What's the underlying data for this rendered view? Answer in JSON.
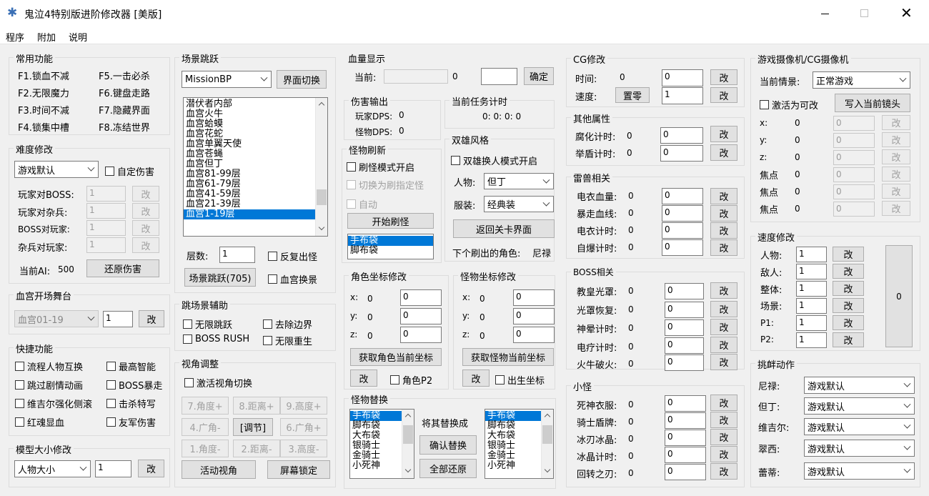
{
  "window": {
    "title": "鬼泣4特别版进阶修改器 [美版]",
    "icon": "snowflake-icon"
  },
  "menu": [
    "程序",
    "附加",
    "说明"
  ],
  "common": {
    "title": "常用功能",
    "items": [
      "F1.锁血不减",
      "F5.一击必杀",
      "F2.无限魔力",
      "F6.键盘走路",
      "F3.时间不减",
      "F7.隐藏界面",
      "F4.锁集中槽",
      "F8.冻结世界"
    ]
  },
  "difficulty": {
    "title": "难度修改",
    "select": "游戏默认",
    "custom_dmg": "自定伤害",
    "rows": [
      {
        "label": "玩家对BOSS:",
        "value": "1",
        "btn": "改"
      },
      {
        "label": "玩家对杂兵:",
        "value": "1",
        "btn": "改"
      },
      {
        "label": "BOSS对玩家:",
        "value": "1",
        "btn": "改"
      },
      {
        "label": "杂兵对玩家:",
        "value": "1",
        "btn": "改"
      }
    ],
    "ai_label": "当前AI:",
    "ai_value": "500",
    "restore": "还原伤害"
  },
  "bloodpalace": {
    "title": "血宫开场舞台",
    "select": "血宫01-19",
    "value": "1",
    "btn": "改"
  },
  "quick": {
    "title": "快捷功能",
    "items": [
      "流程人物互换",
      "最高智能",
      "跳过剧情动画",
      "BOSS暴走",
      "维吉尔强化侧滚",
      "击杀特写",
      "红魂显血",
      "友军伤害"
    ]
  },
  "model": {
    "title": "模型大小修改",
    "select": "人物大小",
    "value": "1",
    "btn": "改"
  },
  "scene": {
    "title": "场景跳跃",
    "select": "MissionBP",
    "switch": "界面切换",
    "list": [
      "潜伏者内部",
      "血宫火牛",
      "血宫蛤蟆",
      "血宫花蛇",
      "血宫单翼天使",
      "血宫苍蝇",
      "血宫但丁",
      "血宫81-99层",
      "血宫61-79层",
      "血宫41-59层",
      "血宫21-39层",
      "血宫1-19层"
    ],
    "floor_label": "层数:",
    "floor_value": "1",
    "repeat": "反复出怪",
    "jump": "场景跳跃(705)",
    "bp_swap": "血宫换景"
  },
  "assist": {
    "title": "跳场景辅助",
    "items": [
      "无限跳跃",
      "去除边界",
      "BOSS RUSH",
      "无限重生"
    ]
  },
  "view": {
    "title": "视角调整",
    "activate": "激活视角切换",
    "buttons": [
      "7.角度+",
      "8.距离+",
      "9.高度+",
      "4.广角-",
      "[调节]",
      "6.广角+",
      "1.角度-",
      "2.距离-",
      "3.高度-"
    ],
    "active": "活动视角",
    "lock": "屏幕锁定"
  },
  "hp": {
    "title": "血量显示",
    "current_label": "当前:",
    "current_value": "0",
    "confirm": "确定"
  },
  "damage": {
    "title": "伤害输出",
    "player_label": "玩家DPS:",
    "player_value": "0",
    "monster_label": "怪物DPS:",
    "monster_value": "0"
  },
  "timer": {
    "title": "当前任务计时",
    "value": "0: 0: 0: 0"
  },
  "refresh": {
    "title": "怪物刷新",
    "mode": "刷怪模式开启",
    "switch": "切换为刷指定怪",
    "auto": "自动",
    "start": "开始刷怪",
    "list": [
      "手布袋",
      "脚布袋"
    ]
  },
  "dual": {
    "title": "双雄风格",
    "mode": "双雄换人模式开启",
    "char_label": "人物:",
    "char_value": "但丁",
    "costume_label": "服装:",
    "costume_value": "经典装",
    "back": "返回关卡界面",
    "next_label": "下个刷出的角色:",
    "next_value": "尼禄"
  },
  "rolepos": {
    "title": "角色坐标修改",
    "coords": [
      {
        "axis": "x:",
        "cur": "0",
        "val": "0"
      },
      {
        "axis": "y:",
        "cur": "0",
        "val": "0"
      },
      {
        "axis": "z:",
        "cur": "0",
        "val": "0"
      }
    ],
    "get": "获取角色当前坐标",
    "btn": "改",
    "p2": "角色P2"
  },
  "monpos": {
    "title": "怪物坐标修改",
    "coords": [
      {
        "axis": "x:",
        "cur": "0",
        "val": "0"
      },
      {
        "axis": "y:",
        "cur": "0",
        "val": "0"
      },
      {
        "axis": "z:",
        "cur": "0",
        "val": "0"
      }
    ],
    "get": "获取怪物当前坐标",
    "btn": "改",
    "spawn": "出生坐标"
  },
  "replace": {
    "title": "怪物替换",
    "list": [
      "手布袋",
      "脚布袋",
      "大布袋",
      "银骑士",
      "金骑士",
      "小死神"
    ],
    "mid_label": "将其替换成",
    "confirm": "确认替换",
    "restore": "全部还原"
  },
  "cg": {
    "title": "CG修改",
    "time_label": "时间:",
    "time_cur": "0",
    "time_val": "0",
    "speed_label": "速度:",
    "reset": "置零",
    "speed_val": "1",
    "btn": "改"
  },
  "other": {
    "title": "其他属性",
    "rows": [
      {
        "label": "腐化计时:",
        "cur": "0",
        "val": "0"
      },
      {
        "label": "举盾计时:",
        "cur": "0",
        "val": "0"
      }
    ],
    "btn": "改"
  },
  "thunder": {
    "title": "雷兽相关",
    "rows": [
      {
        "label": "电衣血量:",
        "cur": "0",
        "val": "0"
      },
      {
        "label": "暴走血线:",
        "cur": "0",
        "val": "0"
      },
      {
        "label": "电衣计时:",
        "cur": "0",
        "val": "0"
      },
      {
        "label": "自爆计时:",
        "cur": "0",
        "val": "0"
      }
    ],
    "btn": "改"
  },
  "boss": {
    "title": "BOSS相关",
    "rows": [
      {
        "label": "教皇光罩:",
        "cur": "0",
        "val": "0"
      },
      {
        "label": "光罩恢复:",
        "cur": "0",
        "val": "0"
      },
      {
        "label": "神晕计时:",
        "cur": "0",
        "val": "0"
      },
      {
        "label": "电疗计时:",
        "cur": "0",
        "val": "0"
      },
      {
        "label": "火牛破火:",
        "cur": "0",
        "val": "0"
      }
    ],
    "btn": "改"
  },
  "minor": {
    "title": "小怪",
    "rows": [
      {
        "label": "死神衣服:",
        "cur": "0",
        "val": "0"
      },
      {
        "label": "骑士盾牌:",
        "cur": "0",
        "val": "0"
      },
      {
        "label": "冰刃冰晶:",
        "cur": "0",
        "val": "0"
      },
      {
        "label": "冰晶计时:",
        "cur": "0",
        "val": "0"
      },
      {
        "label": "回转之刃:",
        "cur": "0",
        "val": "0"
      }
    ],
    "btn": "改"
  },
  "camera": {
    "title": "游戏摄像机/CG摄像机",
    "scene_label": "当前情景:",
    "scene_value": "正常游戏",
    "activate": "激活为可改",
    "write": "写入当前镜头",
    "rows": [
      {
        "label": "x:",
        "cur": "0",
        "val": "0"
      },
      {
        "label": "y:",
        "cur": "0",
        "val": "0"
      },
      {
        "label": "z:",
        "cur": "0",
        "val": "0"
      },
      {
        "label": "焦点",
        "cur": "0",
        "val": "0"
      },
      {
        "label": "焦点",
        "cur": "0",
        "val": "0"
      },
      {
        "label": "焦点",
        "cur": "0",
        "val": "0"
      }
    ],
    "btn": "改"
  },
  "speed": {
    "title": "速度修改",
    "rows": [
      {
        "label": "人物:",
        "val": "1"
      },
      {
        "label": "敌人:",
        "val": "1"
      },
      {
        "label": "整体:",
        "val": "1"
      },
      {
        "label": "场景:",
        "val": "1"
      },
      {
        "label": "P1:",
        "val": "1"
      },
      {
        "label": "P2:",
        "val": "1"
      }
    ],
    "btn": "改",
    "big_value": "0"
  },
  "taunt": {
    "title": "挑衅动作",
    "rows": [
      {
        "label": "尼禄:",
        "val": "游戏默认"
      },
      {
        "label": "但丁:",
        "val": "游戏默认"
      },
      {
        "label": "维吉尔:",
        "val": "游戏默认"
      },
      {
        "label": "翠西:",
        "val": "游戏默认"
      },
      {
        "label": "蕾蒂:",
        "val": "游戏默认"
      }
    ]
  }
}
